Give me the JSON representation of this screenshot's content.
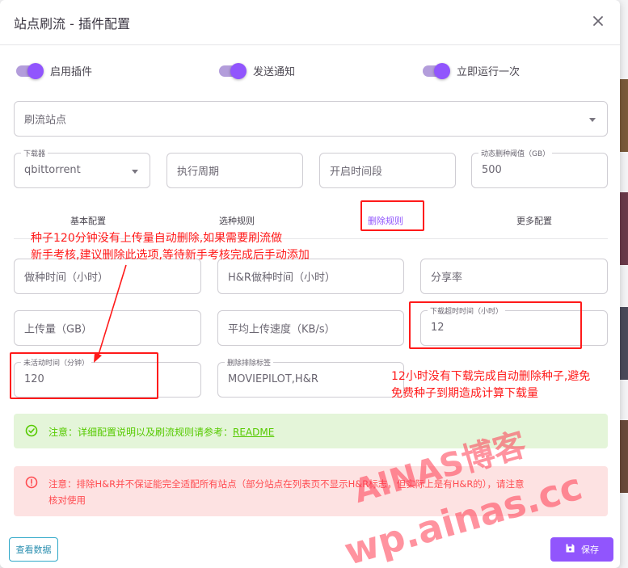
{
  "dialog": {
    "title": "站点刷流 - 插件配置"
  },
  "switches": [
    {
      "label": "启用插件",
      "on": true
    },
    {
      "label": "发送通知",
      "on": true
    },
    {
      "label": "立即运行一次",
      "on": true
    }
  ],
  "fields": {
    "sites": {
      "placeholder": "刷流站点"
    },
    "downloader": {
      "label": "下载器",
      "value": "qbittorrent"
    },
    "cron": {
      "placeholder": "执行周期"
    },
    "active_time": {
      "placeholder": "开启时间段"
    },
    "dynamic_delete": {
      "label": "动态删种阈值（GB）",
      "value": "500"
    },
    "seed_time": {
      "placeholder": "做种时间（小时）"
    },
    "hr_seed_time": {
      "placeholder": "H&R做种时间（小时）"
    },
    "ratio": {
      "placeholder": "分享率"
    },
    "upload": {
      "placeholder": "上传量（GB）"
    },
    "avg_upspeed": {
      "placeholder": "平均上传速度（KB/s）"
    },
    "download_timeout": {
      "label": "下载超时时间（小时）",
      "value": "12"
    },
    "inactive_time": {
      "label": "未活动时间（分钟）",
      "value": "120"
    },
    "exclude_tags": {
      "label": "删除排除标签",
      "value": "MOVIEPILOT,H&R"
    }
  },
  "tabs": [
    {
      "label": "基本配置",
      "active": false
    },
    {
      "label": "选种规则",
      "active": false
    },
    {
      "label": "删除规则",
      "active": true
    },
    {
      "label": "更多配置",
      "active": false
    }
  ],
  "annotations": {
    "inactive_line1": "种子120分钟没有上传量自动删除,如果需要刷流做",
    "inactive_line2": "新手考核,建议删除此选项,等待新手考核完成后手动添加",
    "timeout_line1": "12小时没有下载完成自动删除种子,避免",
    "timeout_line2": "免费种子到期造成计算下载量"
  },
  "alerts": {
    "info_text": "注意：详细配置说明以及刷流规则请参考：",
    "info_link": "README",
    "warn_line1": "注意：排除H&R并不保证能完全适配所有站点（部分站点在列表页不显示H&R标志，但实际上是有H&R的），请注意",
    "warn_line2": "核对使用"
  },
  "buttons": {
    "view_data": "查看数据",
    "save": "保存"
  },
  "watermarks": {
    "line1": "AINAS博客",
    "line2": "wp.ainas.cc"
  },
  "colors": {
    "accent": "#9155fd",
    "annotation": "#ff1a1a",
    "success": "#56ca00",
    "error": "#ff4c51",
    "link": "#2b8fb0"
  },
  "icons": {
    "close": "close-icon",
    "success": "check-circle-icon",
    "error": "alert-circle-icon",
    "save": "floppy-disk-icon"
  }
}
